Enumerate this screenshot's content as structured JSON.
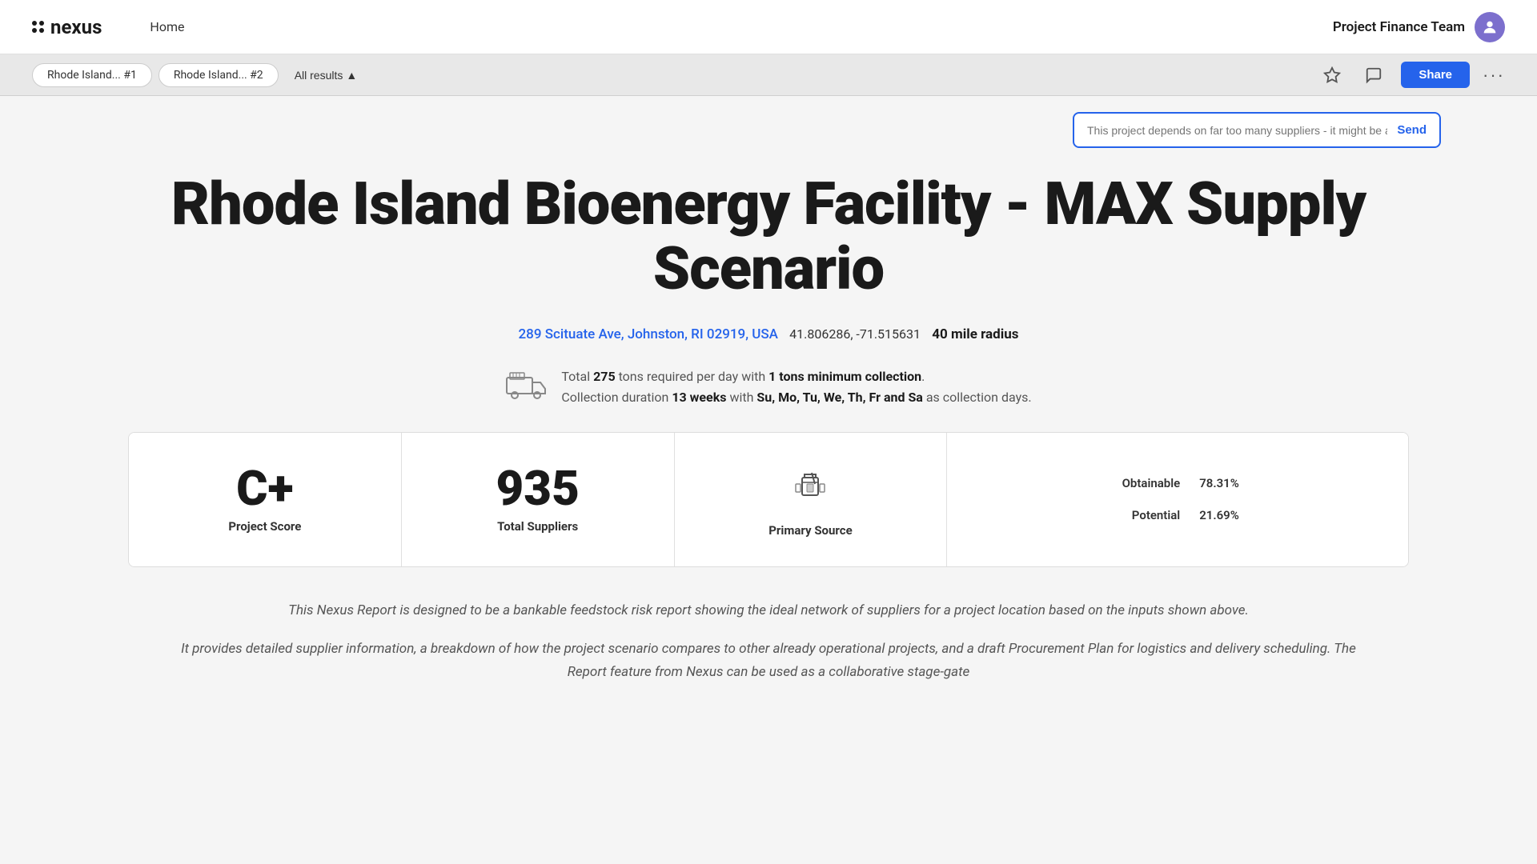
{
  "header": {
    "logo_text": "nexus",
    "nav_home": "Home",
    "team_name": "Project Finance Team",
    "avatar_icon": "👤"
  },
  "tabs": {
    "tab1_label": "Rhode Island... #1",
    "tab2_label": "Rhode Island... #2",
    "all_results_label": "All results",
    "share_label": "Share"
  },
  "ai_chat": {
    "placeholder": "This project depends on far too many suppliers - it might be a risky assumption",
    "send_label": "Send"
  },
  "project": {
    "title": "Rhode Island Bioenergy Facility - MAX Supply Scenario",
    "address_text": "289 Scituate Ave, Johnston, RI 02919, USA",
    "coords": "41.806286, -71.515631",
    "radius": "40 mile radius",
    "collection_total": "275",
    "collection_unit": "tons required per day",
    "collection_min": "1 tons minimum collection",
    "collection_duration": "13 weeks",
    "collection_days": "Su, Mo, Tu, We, Th, Fr and Sa",
    "collection_days_label": "as collection days"
  },
  "stats": {
    "score_value": "C+",
    "score_label": "Project Score",
    "suppliers_value": "935",
    "suppliers_label": "Total Suppliers",
    "source_label": "Primary Source",
    "obtainable_label": "Obtainable",
    "obtainable_pct": "78.31%",
    "obtainable_bar_width": 78.31,
    "potential_label": "Potential",
    "potential_pct": "21.69%",
    "potential_bar_width": 21.69
  },
  "description": {
    "para1": "This Nexus Report is designed to be a bankable feedstock risk report showing the ideal network of suppliers for a project location based on the inputs shown above.",
    "para2": "It provides detailed supplier information, a breakdown of how the project scenario compares to other already operational projects, and a draft Procurement Plan for logistics and delivery scheduling. The Report feature from Nexus can be used as a collaborative stage-gate"
  }
}
